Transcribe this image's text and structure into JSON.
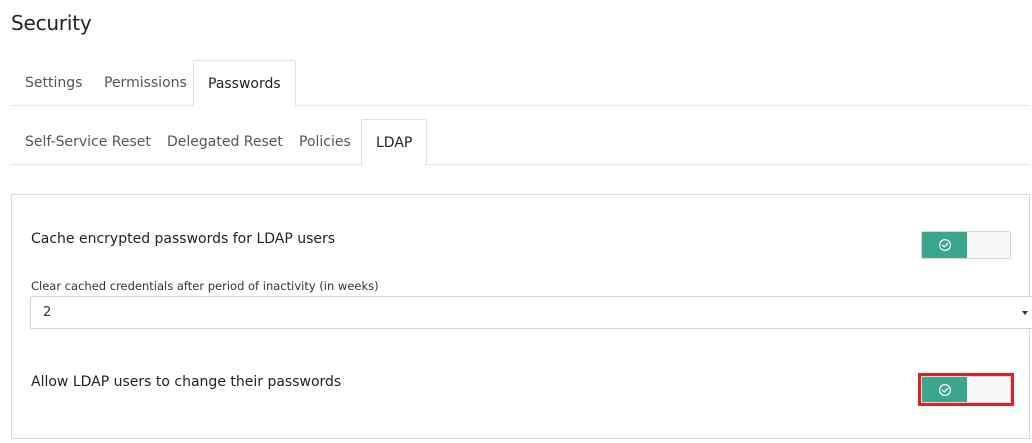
{
  "page": {
    "title": "Security"
  },
  "tabs_main": [
    {
      "label": "Settings",
      "active": false
    },
    {
      "label": "Permissions",
      "active": false
    },
    {
      "label": "Passwords",
      "active": true
    }
  ],
  "tabs_sub": [
    {
      "label": "Self-Service Reset",
      "active": false
    },
    {
      "label": "Delegated Reset",
      "active": false
    },
    {
      "label": "Policies",
      "active": false
    },
    {
      "label": "LDAP",
      "active": true
    }
  ],
  "ldap": {
    "cache_passwords": {
      "label": "Cache encrypted passwords for LDAP users",
      "enabled": true
    },
    "inactivity": {
      "label": "Clear cached credentials after period of inactivity (in weeks)",
      "value": "2"
    },
    "allow_change": {
      "label": "Allow LDAP users to change their passwords",
      "enabled": true,
      "highlighted": true
    }
  },
  "colors": {
    "toggle_on": "#3aa68a",
    "highlight": "#e01f26"
  },
  "icons": {
    "toggle_check": "check-circle-icon",
    "select_caret": "caret-down-icon"
  }
}
